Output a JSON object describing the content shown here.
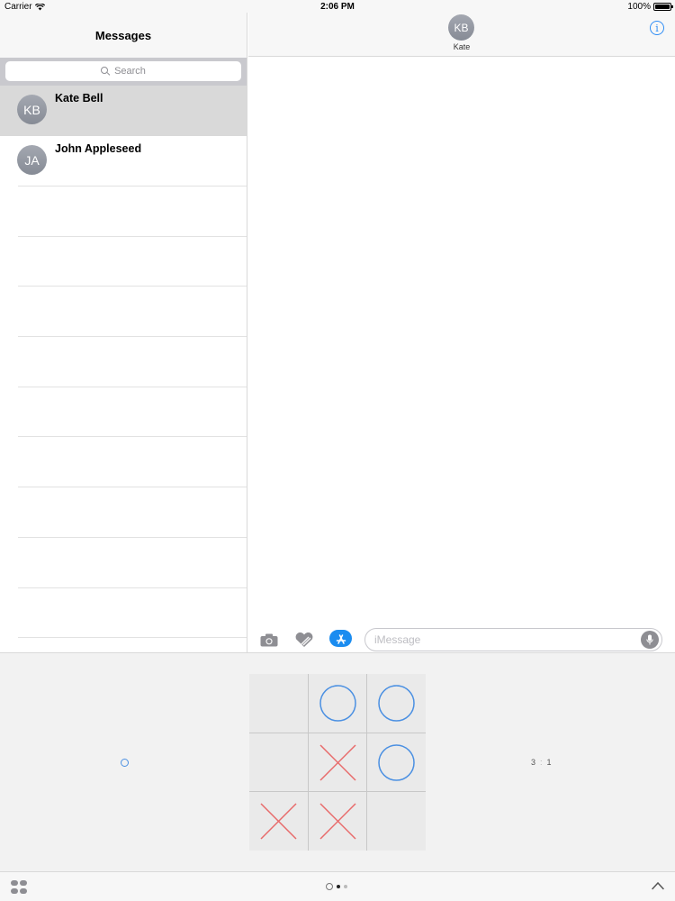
{
  "status_bar": {
    "carrier": "Carrier",
    "time": "2:06 PM",
    "battery": "100%",
    "battery_level": 1.0
  },
  "sidebar": {
    "title": "Messages",
    "search_placeholder": "Search",
    "conversations": [
      {
        "initials": "KB",
        "name": "Kate Bell",
        "selected": true
      },
      {
        "initials": "JA",
        "name": "John Appleseed",
        "selected": false
      }
    ]
  },
  "conversation": {
    "contact_initials": "KB",
    "contact_name": "Kate",
    "input_placeholder": "iMessage"
  },
  "game": {
    "board": [
      [
        "",
        "O",
        "O"
      ],
      [
        "",
        "X",
        "O"
      ],
      [
        "X",
        "X",
        ""
      ]
    ],
    "score_left": "3",
    "score_separator": ":",
    "score_right": "1",
    "colors": {
      "o": "#4b90e2",
      "x": "#e86a6a"
    }
  },
  "colors": {
    "accent": "#2f8df5",
    "appstore": "#1a8cf0"
  },
  "icons": [
    "wifi-icon",
    "battery-icon",
    "search-icon",
    "info-icon",
    "camera-icon",
    "digital-touch-icon",
    "appstore-icon",
    "mic-icon",
    "apps-grid-icon",
    "recents-icon",
    "chevron-up-icon"
  ]
}
